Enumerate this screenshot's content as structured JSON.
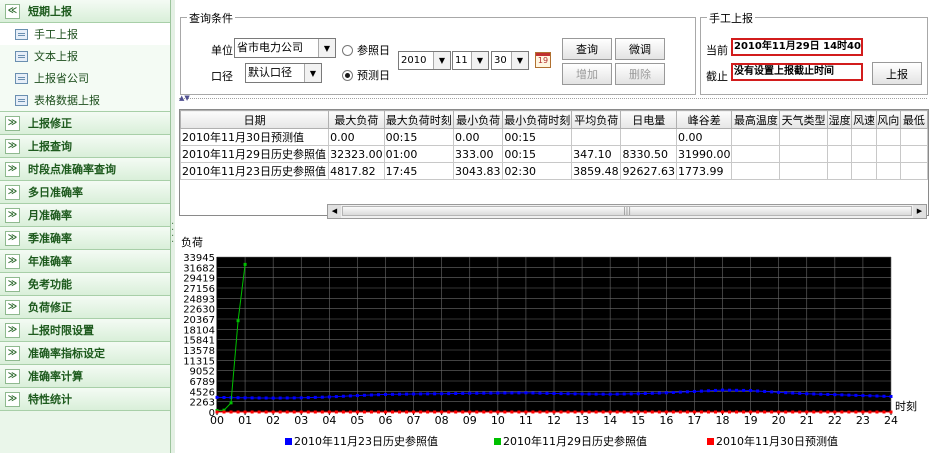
{
  "sidebar": {
    "sections": [
      {
        "label": "短期上报",
        "expanded": true
      },
      {
        "label": "上报修正"
      },
      {
        "label": "上报查询"
      },
      {
        "label": "时段点准确率查询"
      },
      {
        "label": "多日准确率"
      },
      {
        "label": "月准确率"
      },
      {
        "label": "季准确率"
      },
      {
        "label": "年准确率"
      },
      {
        "label": "免考功能"
      },
      {
        "label": "负荷修正"
      },
      {
        "label": "上报时限设置"
      },
      {
        "label": "准确率指标设定"
      },
      {
        "label": "准确率计算"
      },
      {
        "label": "特性统计"
      }
    ],
    "sub_items": [
      {
        "label": "手工上报"
      },
      {
        "label": "文本上报"
      },
      {
        "label": "上报省公司"
      },
      {
        "label": "表格数据上报"
      }
    ],
    "expand_glyph": "≫",
    "collapse_glyph": "≪"
  },
  "query": {
    "title": "查询条件",
    "unit_label": "单位",
    "unit_value": "省市电力公司",
    "caliber_label": "口径",
    "caliber_value": "默认口径",
    "ref_day_label": "参照日",
    "forecast_day_label": "预测日",
    "year": "2010",
    "month": "11",
    "day": "30",
    "calendar_glyph": "19",
    "btn_query": "查询",
    "btn_adjust": "微调",
    "btn_add": "增加",
    "btn_delete": "删除"
  },
  "manual": {
    "title": "手工上报",
    "current_label": "当前",
    "current_value": "2010年11月29日 14时40分",
    "deadline_label": "截止",
    "deadline_value": "没有设置上报截止时间",
    "btn_report": "上报"
  },
  "table": {
    "columns": [
      "日期",
      "最大负荷",
      "最大负荷时刻",
      "最小负荷",
      "最小负荷时刻",
      "平均负荷",
      "日电量",
      "峰谷差",
      "最高温度",
      "天气类型",
      "湿度",
      "风速",
      "风向",
      "最低"
    ],
    "rows": [
      [
        "2010年11月30日预测值",
        "0.00",
        "00:15",
        "0.00",
        "00:15",
        "",
        "",
        "0.00",
        "",
        "",
        "",
        "",
        "",
        ""
      ],
      [
        "2010年11月29日历史参照值",
        "32323.00",
        "01:00",
        "333.00",
        "00:15",
        "347.10",
        "8330.50",
        "31990.00",
        "",
        "",
        "",
        "",
        "",
        ""
      ],
      [
        "2010年11月23日历史参照值",
        "4817.82",
        "17:45",
        "3043.83",
        "02:30",
        "3859.48",
        "92627.63",
        "1773.99",
        "",
        "",
        "",
        "",
        "",
        ""
      ]
    ]
  },
  "chart_data": {
    "type": "line",
    "ylabel": "负荷",
    "xlabel": "时刻",
    "yticks": [
      0,
      2263,
      4526,
      6789,
      9052,
      11315,
      13578,
      15841,
      18104,
      20367,
      22630,
      24893,
      27156,
      29419,
      31682,
      33945
    ],
    "xticks": [
      "00",
      "01",
      "02",
      "03",
      "04",
      "05",
      "06",
      "07",
      "08",
      "09",
      "10",
      "11",
      "12",
      "13",
      "14",
      "15",
      "16",
      "17",
      "18",
      "19",
      "20",
      "21",
      "22",
      "23",
      "24"
    ],
    "ylim": [
      0,
      33945
    ],
    "xlim": [
      0,
      24
    ],
    "background": "#000000",
    "grid": true,
    "legend_position": "bottom",
    "series": [
      {
        "name": "2010年11月23日历史参照值",
        "color": "#0000ff",
        "x": [
          0,
          1,
          2,
          3,
          4,
          5,
          6,
          7,
          8,
          9,
          10,
          11,
          12,
          13,
          14,
          15,
          16,
          17,
          18,
          19,
          20,
          21,
          22,
          23,
          24
        ],
        "y": [
          3200,
          3100,
          3050,
          3100,
          3300,
          3600,
          3850,
          3950,
          4000,
          4100,
          4150,
          4200,
          4050,
          3950,
          3900,
          4000,
          4200,
          4500,
          4800,
          4700,
          4300,
          4000,
          3800,
          3600,
          3400
        ]
      },
      {
        "name": "2010年11月29日历史参照值",
        "color": "#00c000",
        "x": [
          0,
          0.25,
          0.5,
          0.75,
          1
        ],
        "y": [
          333,
          400,
          2000,
          20000,
          32323
        ]
      },
      {
        "name": "2010年11月30日预测值",
        "color": "#ff0000",
        "x": [
          0,
          1,
          2,
          3,
          4,
          5,
          6,
          7,
          8,
          9,
          10,
          11,
          12,
          13,
          14,
          15,
          16,
          17,
          18,
          19,
          20,
          21,
          22,
          23,
          24
        ],
        "y": [
          0,
          0,
          0,
          0,
          0,
          0,
          0,
          0,
          0,
          0,
          0,
          0,
          0,
          0,
          0,
          0,
          0,
          0,
          0,
          0,
          0,
          0,
          0,
          0,
          0
        ]
      }
    ]
  }
}
